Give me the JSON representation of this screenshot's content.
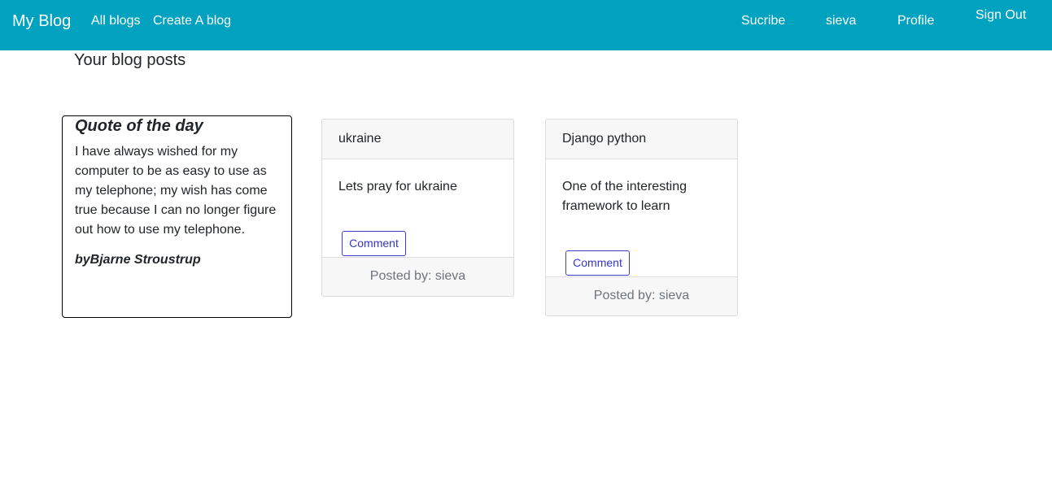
{
  "navbar": {
    "brand": "My Blog",
    "all_blogs": "All blogs",
    "create_blog": "Create A blog",
    "subscribe": "Sucribe",
    "username": "sieva",
    "profile": "Profile",
    "sign_out": "Sign Out",
    "background_color": "#00a2bf"
  },
  "page": {
    "heading": "Your blog posts"
  },
  "quote": {
    "title": "Quote of the day",
    "text": "I have always wished for my computer to be as easy to use as my telephone; my wish has come true because I can no longer figure out how to use my telephone.",
    "author": "byBjarne Stroustrup"
  },
  "posts": [
    {
      "title": "ukraine",
      "body": "Lets pray for ukraine",
      "comment_label": "Comment",
      "footer": "Posted by: sieva"
    },
    {
      "title": "Django python",
      "body": "One of the interesting framework to learn",
      "comment_label": "Comment",
      "footer": "Posted by: sieva"
    }
  ],
  "colors": {
    "button_border": "#3f3fcf",
    "card_header_bg": "#f7f7f7"
  }
}
